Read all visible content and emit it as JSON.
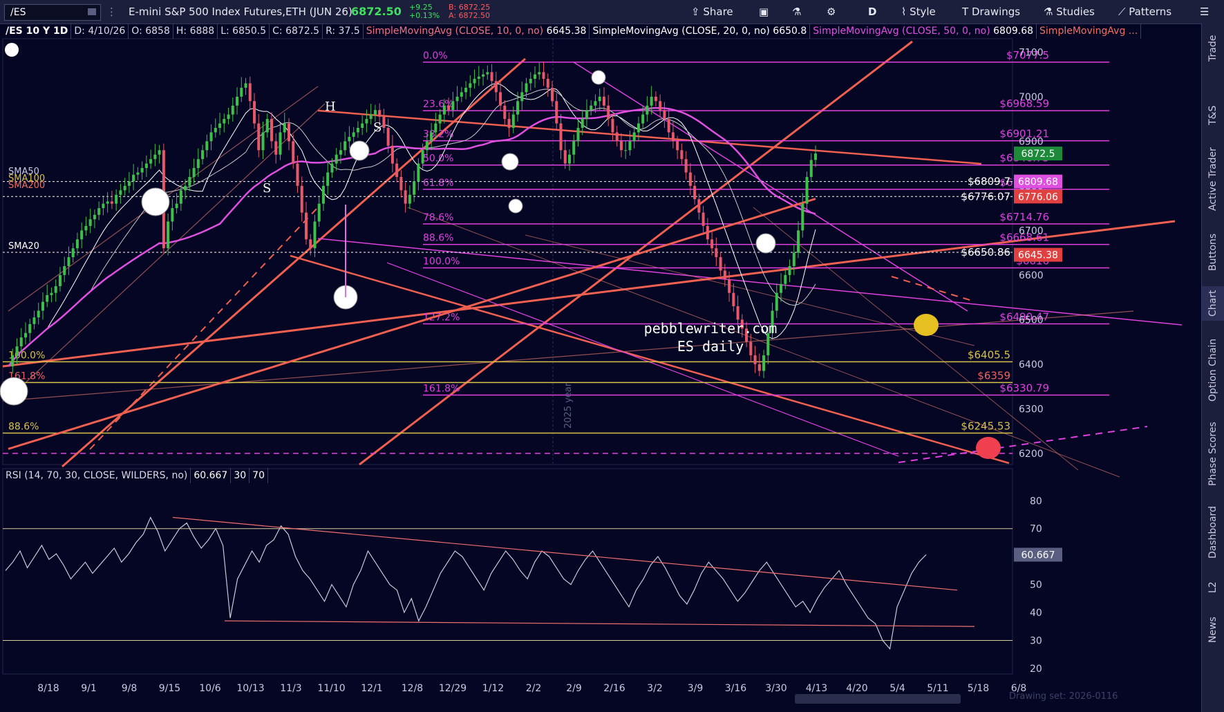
{
  "toolbar": {
    "symbol": "/ES",
    "description": "E-mini S&P 500 Index Futures,ETH (JUN 26)",
    "last": "6872.50",
    "change": "+9.25",
    "change_pct": "+0.13%",
    "bid": "B: 6872.25",
    "ask": "A: 6872.50",
    "share": "Share",
    "period": "D",
    "style": "Style",
    "drawings": "Drawings",
    "studies": "Studies",
    "patterns": "Patterns"
  },
  "sidebar": [
    "Trade",
    "T&S",
    "Active Trader",
    "Buttons",
    "Chart",
    "Option Chain",
    "Phase Scores",
    "Dashboard",
    "L2",
    "News"
  ],
  "header": {
    "title": "/ES 10 Y 1D",
    "date": "D: 4/10/26",
    "open": "O: 6858",
    "high": "H: 6888",
    "low": "L: 6850.5",
    "close": "C: 6872.5",
    "range": "R: 37.5",
    "sma10": "SimpleMovingAvg (CLOSE, 10, 0, no)",
    "sma10_val": "6645.38",
    "sma20": "SimpleMovingAvg (CLOSE, 20, 0, no)",
    "sma20_val": "6650.8",
    "sma50": "SimpleMovingAvg (CLOSE, 50, 0, no)",
    "sma50_val": "6809.68",
    "sma_more": "SimpleMovingAvg ..."
  },
  "rsi_header": {
    "study": "RSI (14, 70, 30, CLOSE, WILDERS, no)",
    "value": "60.667",
    "ob": "30",
    "os": "70"
  },
  "annotations": {
    "watermark": "pebblewriter.com",
    "subtitle": "ES daily",
    "year_label": "2025 year",
    "drawing_set": "Drawing set: 2026-0116"
  },
  "colors": {
    "background": "#050624",
    "candle": "#e8586a",
    "fib": "#e040e0",
    "gold": "#d9c24a",
    "sma10": "#ffffff",
    "sma20": "#c8c8c8",
    "sma50": "#e050e0",
    "sma200": "#f06050",
    "trend": "#f08070"
  },
  "chart_data": [
    {
      "type": "candlestick",
      "title": "/ES 10 Y 1D",
      "x_ticks": [
        "8/18",
        "9/1",
        "9/8",
        "9/15",
        "10/6",
        "10/13",
        "11/3",
        "11/10",
        "12/1",
        "12/8",
        "12/29",
        "1/12",
        "2/2",
        "2/9",
        "2/16",
        "3/2",
        "3/9",
        "3/16",
        "3/30",
        "4/13",
        "4/20",
        "5/4",
        "5/11",
        "5/18",
        "6/8"
      ],
      "ylim": [
        6175,
        7130
      ],
      "y_ticks": [
        6200,
        6300,
        6400,
        6500,
        6600,
        6700,
        6800,
        6900,
        7000,
        7100
      ],
      "closes": [
        6395,
        6420,
        6440,
        6460,
        6470,
        6490,
        6505,
        6520,
        6540,
        6555,
        6560,
        6575,
        6600,
        6620,
        6640,
        6660,
        6680,
        6700,
        6710,
        6725,
        6735,
        6750,
        6760,
        6765,
        6760,
        6780,
        6790,
        6800,
        6810,
        6825,
        6830,
        6840,
        6850,
        6860,
        6870,
        6880,
        6660,
        6720,
        6750,
        6760,
        6790,
        6800,
        6820,
        6840,
        6860,
        6880,
        6900,
        6920,
        6930,
        6940,
        6950,
        6960,
        6980,
        7000,
        7020,
        7030,
        6990,
        6940,
        6880,
        6920,
        6950,
        6900,
        6870,
        6920,
        6940,
        6900,
        6850,
        6800,
        6740,
        6680,
        6660,
        6720,
        6760,
        6800,
        6830,
        6850,
        6870,
        6880,
        6900,
        6910,
        6920,
        6930,
        6940,
        6950,
        6960,
        6970,
        6955,
        6930,
        6890,
        6850,
        6820,
        6790,
        6760,
        6780,
        6810,
        6850,
        6880,
        6900,
        6920,
        6940,
        6960,
        6980,
        6970,
        6990,
        7000,
        7010,
        7020,
        7030,
        7040,
        7045,
        7050,
        7055,
        7035,
        7010,
        6980,
        6950,
        6930,
        6960,
        6990,
        7010,
        7030,
        7040,
        7050,
        7055,
        7040,
        7020,
        6990,
        6940,
        6880,
        6850,
        6870,
        6900,
        6930,
        6950,
        6970,
        6980,
        6990,
        7000,
        6980,
        6950,
        6920,
        6900,
        6880,
        6880,
        6900,
        6920,
        6940,
        6960,
        6980,
        7000,
        6990,
        6970,
        6950,
        6920,
        6900,
        6880,
        6860,
        6830,
        6800,
        6770,
        6740,
        6710,
        6680,
        6660,
        6640,
        6610,
        6590,
        6560,
        6530,
        6500,
        6480,
        6450,
        6420,
        6400,
        6385,
        6420,
        6470,
        6520,
        6560,
        6580,
        6600,
        6620,
        6650,
        6700,
        6760,
        6820,
        6858,
        6872.5
      ],
      "series": [
        {
          "name": "SMA10",
          "value": 6645.38
        },
        {
          "name": "SMA20",
          "value": 6650.8
        },
        {
          "name": "SMA50",
          "value": 6809.68
        },
        {
          "name": "SMA200",
          "value": 6776.07
        }
      ],
      "price_tags": [
        {
          "value": 6872.5,
          "label": "6872.5",
          "color": "#1d8a3a"
        },
        {
          "value": 6809.68,
          "label": "6809.68",
          "color": "#e050e0"
        },
        {
          "value": 6776.06,
          "label": "6776.06",
          "color": "#e04040"
        },
        {
          "value": 6645.38,
          "label": "6645.38",
          "color": "#e04040"
        }
      ],
      "fib_levels": [
        {
          "pct": "0.0%",
          "price": 7077.5,
          "label": "$7077.5"
        },
        {
          "pct": "23.6%",
          "price": 6968.59,
          "label": "$6968.59"
        },
        {
          "pct": "38.2%",
          "price": 6901.21,
          "label": "$6901.21"
        },
        {
          "pct": "50.0%",
          "price": 6846.75,
          "label": "$6846.75"
        },
        {
          "pct": "61.8%",
          "price": 6792.29,
          "label": "$6792.29"
        },
        {
          "pct": "78.6%",
          "price": 6714.76,
          "label": "$6714.76"
        },
        {
          "pct": "88.6%",
          "price": 6668.61,
          "label": "$6668.61"
        },
        {
          "pct": "100.0%",
          "price": 6616,
          "label": "$6616"
        },
        {
          "pct": "127.2%",
          "price": 6490.47,
          "label": "$6490.47"
        },
        {
          "pct": "161.8%",
          "price": 6330.79,
          "label": "$6330.79"
        }
      ],
      "gold_levels": [
        {
          "pct": "100.0%",
          "price": 6405.5,
          "label": "$6405.5"
        },
        {
          "pct": "161.8%",
          "price": 6359,
          "label": "$6359"
        },
        {
          "pct": "88.6%",
          "price": 6245.53,
          "label": "$6245.53"
        }
      ],
      "dotted_levels": [
        {
          "price": 6809.7,
          "label": "$6809.7"
        },
        {
          "price": 6776.07,
          "label": "$6776.07"
        },
        {
          "price": 6650.86,
          "label": "$6650.86"
        }
      ],
      "sma_tags": [
        "SMA50",
        "SMA100",
        "SMA200",
        "SMA20"
      ],
      "pattern_labels": [
        "H",
        "S",
        "S"
      ]
    },
    {
      "type": "line",
      "title": "RSI (14, 70, 30, CLOSE, WILDERS, no)",
      "ylim": [
        18,
        86
      ],
      "y_ticks": [
        20,
        30,
        40,
        50,
        60,
        70,
        80
      ],
      "levels": [
        30,
        70
      ],
      "last_value": 60.667,
      "values": [
        55,
        58,
        62,
        56,
        60,
        64,
        59,
        61,
        57,
        52,
        55,
        58,
        54,
        57,
        60,
        63,
        58,
        61,
        65,
        68,
        74,
        69,
        62,
        66,
        70,
        72,
        67,
        63,
        66,
        70,
        64,
        38,
        52,
        57,
        62,
        58,
        64,
        66,
        71,
        68,
        60,
        55,
        52,
        48,
        44,
        50,
        46,
        42,
        50,
        55,
        62,
        58,
        54,
        50,
        48,
        40,
        45,
        37,
        42,
        48,
        54,
        58,
        62,
        60,
        56,
        52,
        48,
        54,
        58,
        62,
        59,
        55,
        52,
        58,
        62,
        60,
        56,
        52,
        50,
        55,
        59,
        62,
        58,
        54,
        50,
        46,
        42,
        48,
        52,
        57,
        60,
        56,
        51,
        46,
        43,
        48,
        54,
        58,
        55,
        52,
        48,
        44,
        47,
        51,
        55,
        58,
        54,
        50,
        46,
        42,
        44,
        40,
        45,
        49,
        52,
        55,
        50,
        46,
        42,
        38,
        36,
        30,
        27,
        42,
        48,
        54,
        58,
        60.667
      ]
    }
  ]
}
